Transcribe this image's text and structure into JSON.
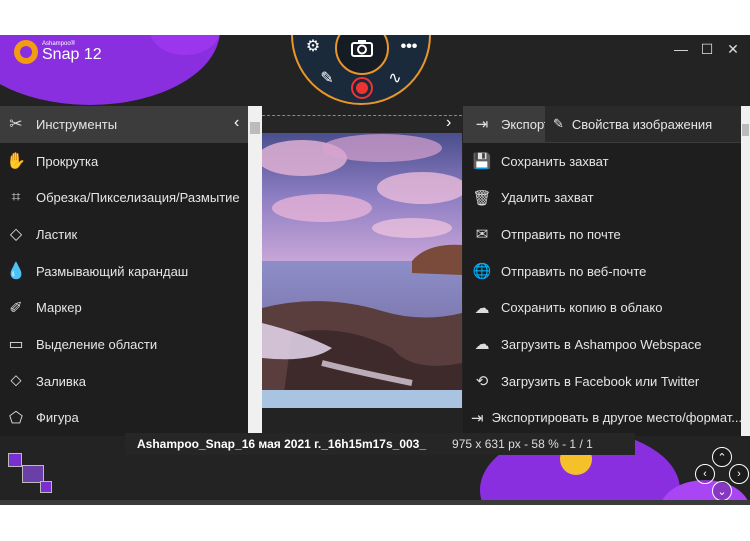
{
  "app": {
    "brand": "Ashampoo®",
    "name": "Snap 12"
  },
  "window_controls": {
    "minimize": "—",
    "maximize": "☐",
    "close": "✕"
  },
  "capture_wheel": {
    "settings": "⚙",
    "camera": "📷",
    "more": "•••",
    "pen": "✎",
    "scribble": "∿",
    "record": "record"
  },
  "left_tools": [
    {
      "label": "Инструменты",
      "icon": "wrench-icon",
      "glyph": "✂"
    },
    {
      "label": "Прокрутка",
      "icon": "hand-icon",
      "glyph": "✋"
    },
    {
      "label": "Обрезка/Пикселизация/Размытие",
      "icon": "crop-icon",
      "glyph": "⌗"
    },
    {
      "label": "Ластик",
      "icon": "eraser-icon",
      "glyph": "◇"
    },
    {
      "label": "Размывающий карандаш",
      "icon": "drop-icon",
      "glyph": "💧"
    },
    {
      "label": "Маркер",
      "icon": "marker-icon",
      "glyph": "✐"
    },
    {
      "label": "Выделение области",
      "icon": "selection-icon",
      "glyph": "▭"
    },
    {
      "label": "Заливка",
      "icon": "fill-icon",
      "glyph": "⬦"
    },
    {
      "label": "Фигура",
      "icon": "shape-icon",
      "glyph": "⬠"
    }
  ],
  "right_actions": [
    {
      "label": "Экспорт",
      "icon": "export-icon",
      "glyph": "⇥"
    },
    {
      "label": "Сохранить захват",
      "icon": "save-icon",
      "glyph": "💾"
    },
    {
      "label": "Удалить захват",
      "icon": "trash-icon",
      "glyph": "🗑"
    },
    {
      "label": "Отправить по почте",
      "icon": "mail-icon",
      "glyph": "✉"
    },
    {
      "label": "Отправить по веб-почте",
      "icon": "globe-icon",
      "glyph": "🌐"
    },
    {
      "label": "Сохранить копию в облако",
      "icon": "cloud-upload-icon",
      "glyph": "☁"
    },
    {
      "label": "Загрузить в Ashampoo Webspace",
      "icon": "cloud-icon",
      "glyph": "☁"
    },
    {
      "label": "Загрузить в Facebook или Twitter",
      "icon": "share-icon",
      "glyph": "⟲"
    },
    {
      "label": "Экспортировать в другое место/формат...",
      "icon": "export-file-icon",
      "glyph": "⇥"
    }
  ],
  "image_properties": {
    "label": "Свойства изображения",
    "glyph": "✎"
  },
  "status_bar": {
    "filename": "Ashampoo_Snap_16 мая 2021 г._16h15m17s_003_",
    "info": "975 x 631 px - 58 % - 1 / 1"
  },
  "colors": {
    "accent_purple": "#8a2fe0",
    "accent_orange": "#e8962a",
    "record_red": "#ee3333",
    "panel_dark": "#1e1e1e"
  }
}
